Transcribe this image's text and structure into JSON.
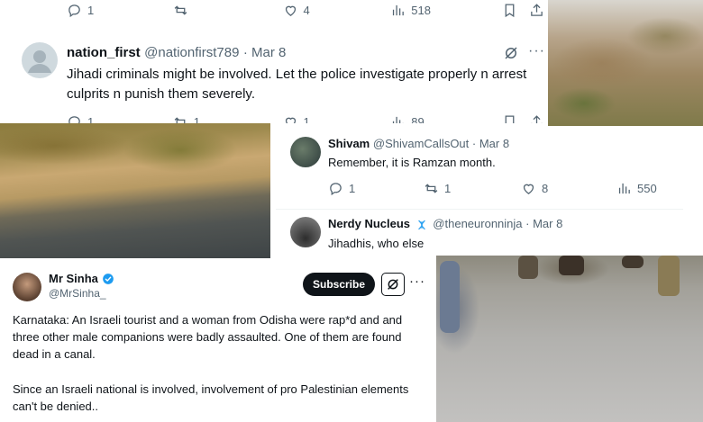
{
  "tweet_top_metrics": {
    "replies": "1",
    "likes": "4",
    "views": "518"
  },
  "tweet_nation_first": {
    "name": "nation_first",
    "handle": "@nationfirst789",
    "date": "· Mar 8",
    "text": "Jihadi criminals might be involved. Let the police investigate properly n arrest culprits n punish them severely.",
    "replies": "1",
    "reposts": "1",
    "likes": "1",
    "views": "89"
  },
  "tweet_shivam": {
    "name": "Shivam",
    "handle": "@ShivamCallsOut",
    "date": "· Mar 8",
    "text": "Remember, it is Ramzan month.",
    "replies": "1",
    "reposts": "1",
    "likes": "8",
    "views": "550"
  },
  "tweet_nerdy": {
    "name": "Nerdy Nucleus",
    "handle": "@theneuronninja",
    "date": "· Mar 8",
    "text": "Jihadhis, who else"
  },
  "tweet_mr_sinha": {
    "name": "Mr Sinha",
    "handle": "@MrSinha_",
    "subscribe_label": "Subscribe",
    "paragraph1": "Karnataka: An Israeli tourist and a woman from Odisha were rap*d and and three other male companions were badly assaulted. One of them are found dead in a canal.",
    "paragraph2": "Since an Israeli national is involved, involvement of pro Palestinian elements can't be denied.."
  },
  "colors": {
    "text_primary": "#0f1419",
    "text_secondary": "#536471",
    "verified_blue": "#1d9bf0",
    "button_dark": "#0f1419"
  },
  "icons": [
    "reply-icon",
    "repost-icon",
    "like-icon",
    "views-icon",
    "bookmark-icon",
    "share-icon",
    "grok-icon",
    "more-icon",
    "verified-badge-icon",
    "dna-icon"
  ]
}
